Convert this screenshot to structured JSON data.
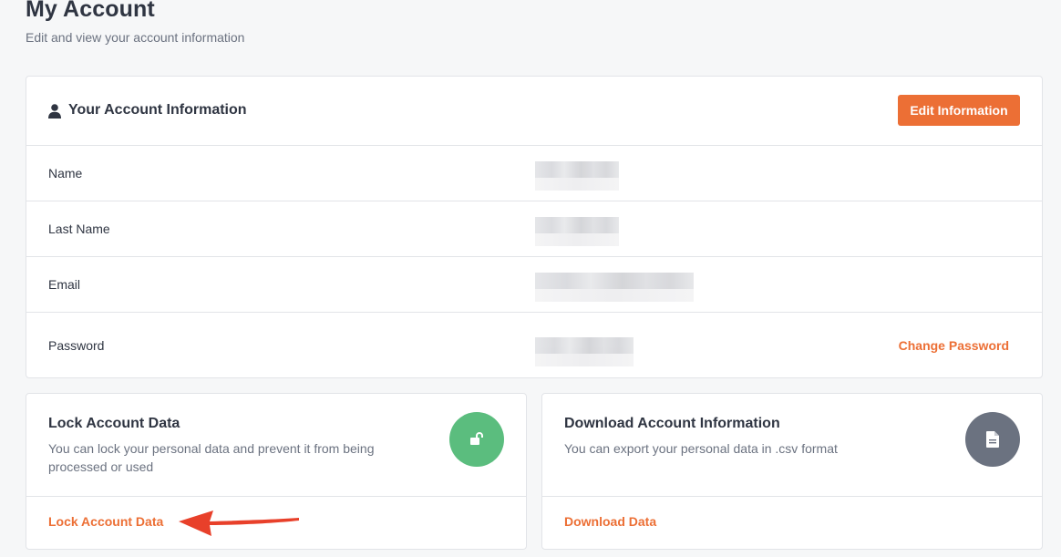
{
  "header": {
    "title": "My Account",
    "subtitle": "Edit and view your account information"
  },
  "account_info": {
    "title": "Your Account Information",
    "edit_button": "Edit Information",
    "rows": [
      {
        "label": "Name",
        "value_redacted": true
      },
      {
        "label": "Last Name",
        "value_redacted": true
      },
      {
        "label": "Email",
        "value_redacted": true
      },
      {
        "label": "Password",
        "value_redacted": true,
        "action": "Change Password"
      }
    ]
  },
  "lock_card": {
    "title": "Lock Account Data",
    "description": "You can lock your personal data and prevent it from being processed or used",
    "icon": "unlock-icon",
    "icon_color": "#5bbd7e",
    "link": "Lock Account Data"
  },
  "download_card": {
    "title": "Download Account Information",
    "description": "You can export your personal data in .csv format",
    "icon": "document-icon",
    "icon_color": "#6b7280",
    "link": "Download Data"
  },
  "colors": {
    "accent": "#ec6f35",
    "annotation_arrow": "#e8402a"
  }
}
